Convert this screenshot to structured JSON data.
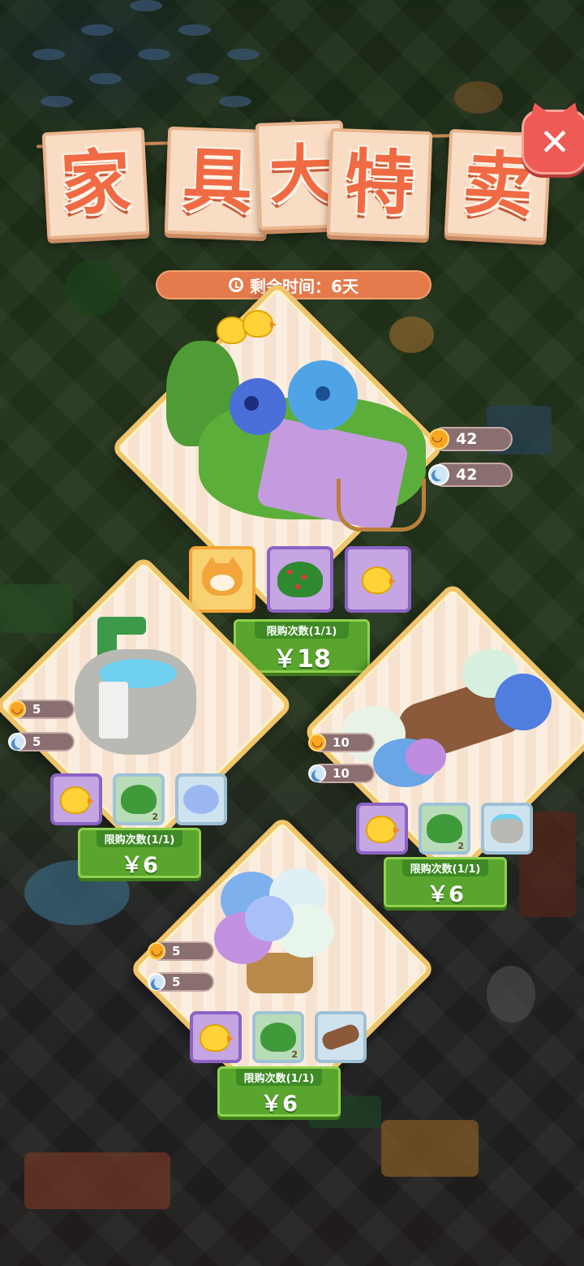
{
  "title": {
    "chars": [
      "家",
      "具",
      "大",
      "特",
      "卖"
    ]
  },
  "timer": {
    "text": "剩余时间：6天",
    "icon": "clock-icon"
  },
  "close": {
    "label": "✕",
    "icon": "close-icon"
  },
  "offers": [
    {
      "id": "bed",
      "item_name_icon": "flower-bed-icon",
      "stats": [
        {
          "icon": "sun-icon",
          "value": "42"
        },
        {
          "icon": "moon-icon",
          "value": "42"
        }
      ],
      "rewards": [
        {
          "icon": "cat-pillow-icon",
          "style": "gold",
          "count": ""
        },
        {
          "icon": "red-berry-bush-icon",
          "style": "purple",
          "count": ""
        },
        {
          "icon": "chick-icon",
          "style": "purple",
          "count": ""
        }
      ],
      "limit": "限购次数(1/1)",
      "price": "￥18"
    },
    {
      "id": "stone-basin",
      "item_name_icon": "stone-basin-icon",
      "stats": [
        {
          "icon": "sun-icon",
          "value": "5"
        },
        {
          "icon": "moon-icon",
          "value": "5"
        }
      ],
      "rewards": [
        {
          "icon": "chick-icon",
          "style": "purple",
          "count": ""
        },
        {
          "icon": "green-bush-icon",
          "style": "green",
          "count": "2"
        },
        {
          "icon": "hydrangea-cart-icon",
          "style": "blue",
          "count": ""
        }
      ],
      "limit": "限购次数(1/1)",
      "price": "￥6"
    },
    {
      "id": "hydrangea-log",
      "item_name_icon": "hydrangea-log-icon",
      "stats": [
        {
          "icon": "sun-icon",
          "value": "10"
        },
        {
          "icon": "moon-icon",
          "value": "10"
        }
      ],
      "rewards": [
        {
          "icon": "chick-icon",
          "style": "purple",
          "count": ""
        },
        {
          "icon": "green-bush-icon",
          "style": "green",
          "count": "2"
        },
        {
          "icon": "stone-basin-icon",
          "style": "blue",
          "count": ""
        }
      ],
      "limit": "限购次数(1/1)",
      "price": "￥6"
    },
    {
      "id": "hydrangea-pot",
      "item_name_icon": "hydrangea-pot-icon",
      "stats": [
        {
          "icon": "sun-icon",
          "value": "5"
        },
        {
          "icon": "moon-icon",
          "value": "5"
        }
      ],
      "rewards": [
        {
          "icon": "chick-icon",
          "style": "purple",
          "count": ""
        },
        {
          "icon": "green-bush-icon",
          "style": "green",
          "count": "2"
        },
        {
          "icon": "hydrangea-log-icon",
          "style": "blue",
          "count": ""
        }
      ],
      "limit": "限购次数(1/1)",
      "price": "￥6"
    }
  ],
  "colors": {
    "title_text": "#f06a44",
    "card_bg": "#f9dcc4",
    "buy_green": "#5aa52d",
    "diamond_border": "#f1c46a",
    "close_red": "#ef5b54"
  }
}
